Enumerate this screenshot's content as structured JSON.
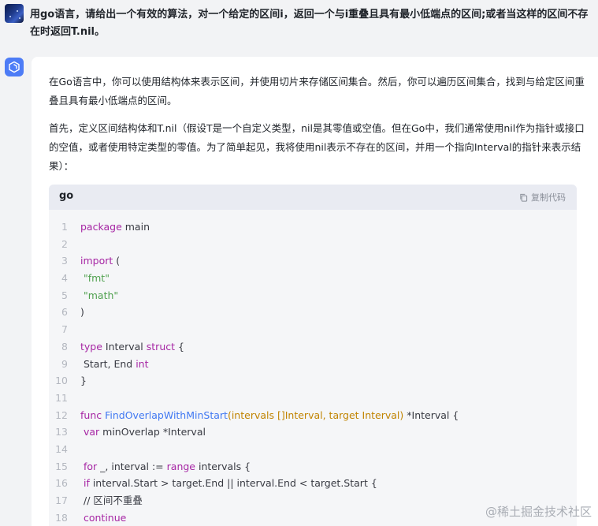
{
  "user": {
    "question": "用go语言，请给出一个有效的算法，对一个给定的区间i，返回一个与i重叠且具有最小低端点的区间;或者当这样的区间不存在时返回T.nil。"
  },
  "answer": {
    "paragraph1": "在Go语言中，你可以使用结构体来表示区间，并使用切片来存储区间集合。然后，你可以遍历区间集合，找到与给定区间重叠且具有最小低端点的区间。",
    "paragraph2": "首先，定义区间结构体和T.nil（假设T是一个自定义类型，nil是其零值或空值。但在Go中，我们通常使用nil作为指针或接口的空值，或者使用特定类型的零值。为了简单起见，我将使用nil表示不存在的区间，并用一个指向Interval的指针来表示结果）："
  },
  "code": {
    "language": "go",
    "copy_label": "复制代码",
    "lines": [
      {
        "n": "1",
        "parts": [
          {
            "c": "kw",
            "t": "package"
          },
          {
            "c": "",
            "t": " main"
          }
        ]
      },
      {
        "n": "2",
        "parts": []
      },
      {
        "n": "3",
        "parts": [
          {
            "c": "kw",
            "t": "import"
          },
          {
            "c": "",
            "t": " ("
          }
        ]
      },
      {
        "n": "4",
        "parts": [
          {
            "c": "",
            "t": " "
          },
          {
            "c": "str",
            "t": "\"fmt\""
          }
        ]
      },
      {
        "n": "5",
        "parts": [
          {
            "c": "",
            "t": " "
          },
          {
            "c": "str",
            "t": "\"math\""
          }
        ]
      },
      {
        "n": "6",
        "parts": [
          {
            "c": "",
            "t": ")"
          }
        ]
      },
      {
        "n": "7",
        "parts": []
      },
      {
        "n": "8",
        "parts": [
          {
            "c": "kw",
            "t": "type"
          },
          {
            "c": "",
            "t": " Interval "
          },
          {
            "c": "kw",
            "t": "struct"
          },
          {
            "c": "",
            "t": " {"
          }
        ]
      },
      {
        "n": "9",
        "parts": [
          {
            "c": "",
            "t": " Start, End "
          },
          {
            "c": "kw",
            "t": "int"
          }
        ]
      },
      {
        "n": "10",
        "parts": [
          {
            "c": "",
            "t": "}"
          }
        ]
      },
      {
        "n": "11",
        "parts": []
      },
      {
        "n": "12",
        "parts": [
          {
            "c": "kw",
            "t": "func"
          },
          {
            "c": "",
            "t": " "
          },
          {
            "c": "fn",
            "t": "FindOverlapWithMinStart"
          },
          {
            "c": "ty",
            "t": "(intervals []Interval, target Interval)"
          },
          {
            "c": "",
            "t": " *Interval {"
          }
        ]
      },
      {
        "n": "13",
        "parts": [
          {
            "c": "",
            "t": " "
          },
          {
            "c": "kw",
            "t": "var"
          },
          {
            "c": "",
            "t": " minOverlap *Interval"
          }
        ]
      },
      {
        "n": "14",
        "parts": []
      },
      {
        "n": "15",
        "parts": [
          {
            "c": "",
            "t": " "
          },
          {
            "c": "kw",
            "t": "for"
          },
          {
            "c": "",
            "t": " _, interval := "
          },
          {
            "c": "kw",
            "t": "range"
          },
          {
            "c": "",
            "t": " intervals {"
          }
        ]
      },
      {
        "n": "16",
        "parts": [
          {
            "c": "",
            "t": " "
          },
          {
            "c": "kw",
            "t": "if"
          },
          {
            "c": "",
            "t": " interval.Start > target.End || interval.End < target.Start {"
          }
        ]
      },
      {
        "n": "17",
        "parts": [
          {
            "c": "",
            "t": " "
          },
          {
            "c": "cm",
            "t": "// 区间不重叠"
          }
        ]
      },
      {
        "n": "18",
        "parts": [
          {
            "c": "",
            "t": " "
          },
          {
            "c": "kw",
            "t": "continue"
          }
        ]
      }
    ]
  },
  "watermark": "@稀土掘金技术社区",
  "icons": {
    "bot": "cube-logo-icon",
    "copy": "copy-icon"
  },
  "colors": {
    "bot_avatar": "#4d7cf6",
    "keyword": "#a626a4",
    "string": "#50a14f",
    "function": "#4078f2",
    "param": "#c18401"
  }
}
